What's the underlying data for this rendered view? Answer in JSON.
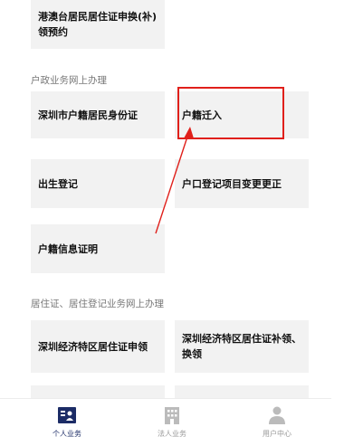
{
  "cards": {
    "hkmo_permit": "港澳台居民居住证申换(补)领预约",
    "shenzhen_id": "深圳市户籍居民身份证",
    "hukou_move": "户籍迁入",
    "birth_reg": "出生登记",
    "hukou_correction": "户口登记项目变更更正",
    "hukou_cert": "户籍信息证明",
    "residence_apply": "深圳经济特区居住证申领",
    "residence_reissue": "深圳经济特区居住证补领、换领"
  },
  "sections": {
    "household": "户政业务网上办理",
    "residence": "居住证、居住登记业务网上办理"
  },
  "bottom_nav": {
    "personal": "个人业务",
    "corporate": "法人业务",
    "user_center": "用户中心"
  },
  "colors": {
    "highlight": "#e0201b",
    "active_icon": "#1c2c66",
    "inactive_icon": "#bbbbbb"
  },
  "icons": {
    "personal": "id-card-icon",
    "corporate": "building-icon",
    "user_center": "person-icon"
  }
}
